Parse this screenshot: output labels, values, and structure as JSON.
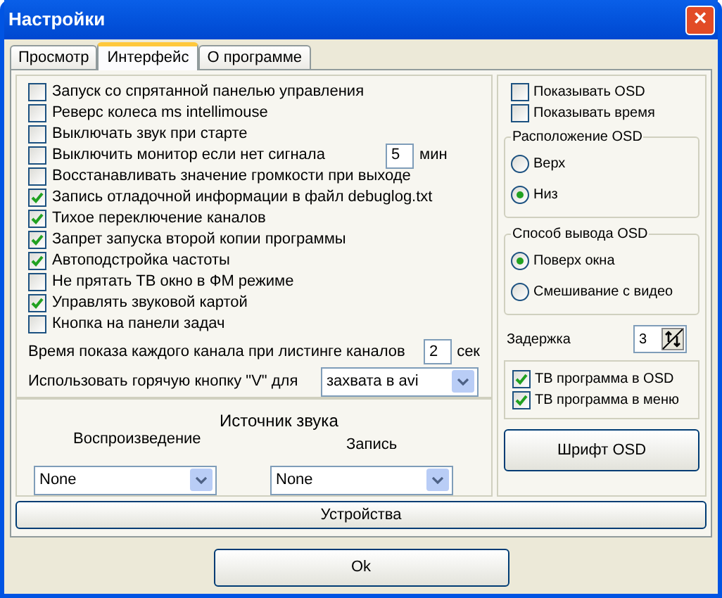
{
  "window": {
    "title": "Настройки",
    "close": "×"
  },
  "tabs": [
    {
      "label": "Просмотр",
      "selected": false
    },
    {
      "label": "Интерфейс",
      "selected": true
    },
    {
      "label": "О программе",
      "selected": false
    }
  ],
  "options": [
    {
      "kind": "check",
      "label": "Запуск со спрятанной панелью управления",
      "checked": false
    },
    {
      "kind": "check",
      "label": "Реверс колеса ms intellimouse",
      "checked": false
    },
    {
      "kind": "check",
      "label": "Выключать звук при старте",
      "checked": false
    },
    {
      "kind": "check_field",
      "label": "Выключить монитор если нет сигнала",
      "checked": false,
      "value": "5",
      "unit": "мин"
    },
    {
      "kind": "check",
      "label": "Восстанавливать значение громкости при выходе",
      "checked": false
    },
    {
      "kind": "check",
      "label": "Запись отладочной информации в файл debuglog.txt",
      "checked": true
    },
    {
      "kind": "check",
      "label": "Тихое переключение каналов",
      "checked": true
    },
    {
      "kind": "check",
      "label": "Запрет запуска второй копии программы",
      "checked": true
    },
    {
      "kind": "check",
      "label": "Автоподстройка частоты",
      "checked": true
    },
    {
      "kind": "check",
      "label": "Не прятать ТВ окно в ФМ режиме",
      "checked": false
    },
    {
      "kind": "check",
      "label": "Управлять звуковой картой",
      "checked": true
    },
    {
      "kind": "check",
      "label": "Кнопка на панели задач",
      "checked": false
    },
    {
      "kind": "field",
      "label": "Время показа каждого канала при листинге каналов",
      "value": "2",
      "unit": "сек"
    },
    {
      "kind": "select",
      "label": "Использовать горячую кнопку \"V\" для",
      "value": "захвата в avi"
    }
  ],
  "sound": {
    "title": "Источник звука",
    "playback": {
      "label": "Воспроизведение",
      "value": "None"
    },
    "record": {
      "label": "Запись",
      "value": "None"
    }
  },
  "osd_checks": [
    {
      "label": "Показывать OSD",
      "checked": false
    },
    {
      "label": "Показывать время",
      "checked": false
    }
  ],
  "radio_groups": [
    {
      "title": "Расположение OSD",
      "options": [
        {
          "label": "Верх",
          "selected": false
        },
        {
          "label": "Низ",
          "selected": true
        }
      ]
    },
    {
      "title": "Способ вывода OSD",
      "options": [
        {
          "label": "Поверх окна",
          "selected": true
        },
        {
          "label": "Смешивание с видео",
          "selected": false
        }
      ]
    }
  ],
  "delay": {
    "label": "Задержка",
    "value": "3"
  },
  "tv_checks": [
    {
      "label": "ТВ программа в OSD",
      "checked": true
    },
    {
      "label": "ТВ программа в меню",
      "checked": true
    }
  ],
  "font_button": "Шрифт OSD",
  "devices_button": "Устройства",
  "ok_button": "Ok"
}
